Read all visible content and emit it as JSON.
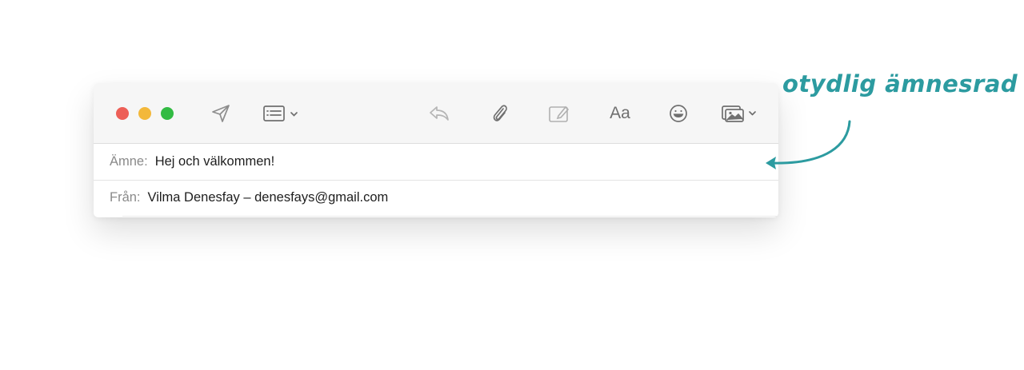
{
  "toolbar": {
    "traffic_lights": [
      "close",
      "minimize",
      "zoom"
    ],
    "icons": [
      "send-icon",
      "header-fields-icon",
      "reply-icon",
      "attachment-icon",
      "markup-icon",
      "font-icon",
      "emoji-icon",
      "photo-browser-icon"
    ],
    "font_button_label": "Aa"
  },
  "fields": {
    "subject_label": "Ämne:",
    "subject_value": "Hej och välkommen!",
    "from_label": "Från:",
    "from_value": "Vilma Denesfay – denesfays@gmail.com"
  },
  "annotation": {
    "text": "otydlig ämnesrad",
    "color": "#2c9ba0"
  },
  "colors": {
    "close": "#ed5f57",
    "minimize": "#f3b83a",
    "zoom": "#32bb43"
  }
}
